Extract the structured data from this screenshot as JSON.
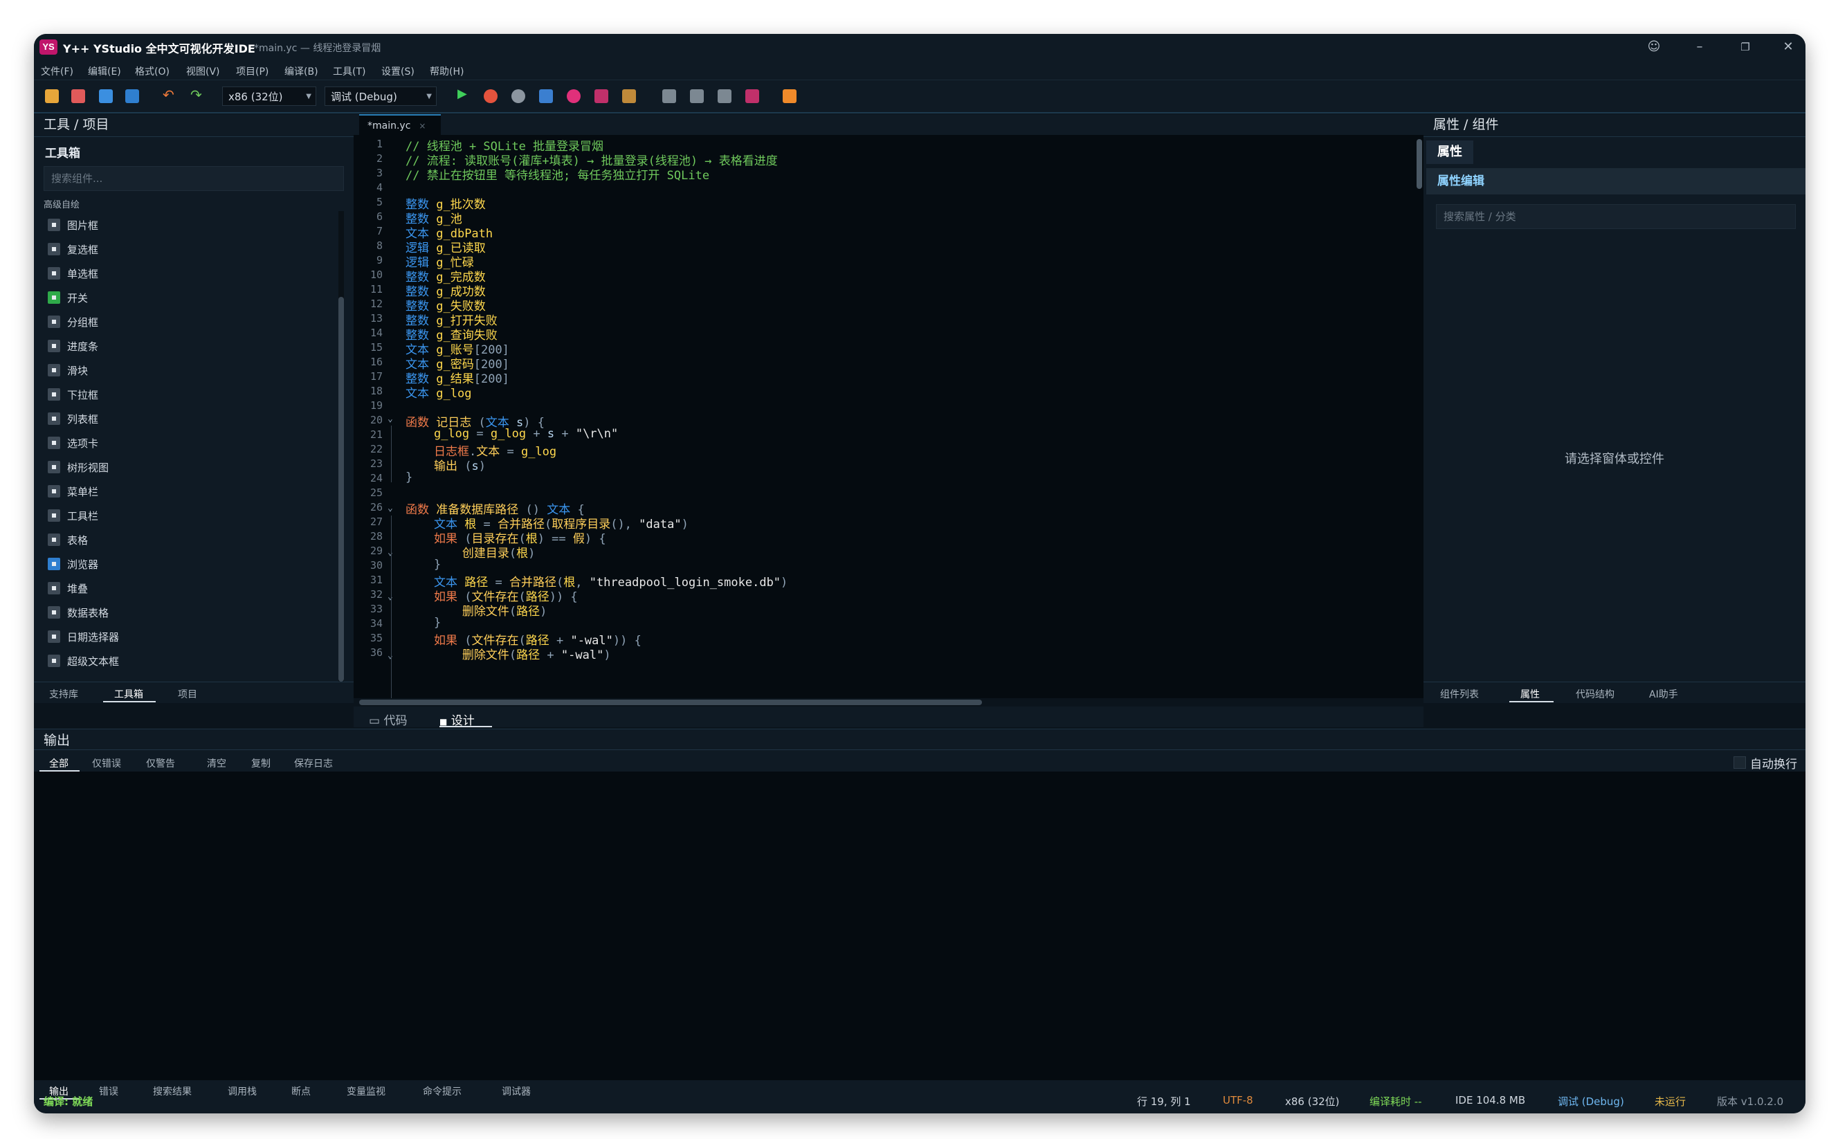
{
  "window": {
    "app_title": "Y++ YStudio 全中文可视化开发IDE",
    "doc_title": "*main.yc — 线程池登录冒烟",
    "logo": "YS"
  },
  "menu": [
    "文件(F)",
    "编辑(E)",
    "格式(O)",
    "视图(V)",
    "项目(P)",
    "编译(B)",
    "工具(T)",
    "设置(S)",
    "帮助(H)"
  ],
  "toolbar": {
    "arch": "x86 (32位)",
    "config": "调试 (Debug)"
  },
  "left": {
    "header": "工具 / 项目",
    "toolbox_title": "工具箱",
    "search_placeholder": "搜索组件...",
    "category": "高级自绘",
    "items": [
      "图片框",
      "复选框",
      "单选框",
      "开关",
      "分组框",
      "进度条",
      "滑块",
      "下拉框",
      "列表框",
      "选项卡",
      "树形视图",
      "菜单栏",
      "工具栏",
      "表格",
      "浏览器",
      "堆叠",
      "数据表格",
      "日期选择器",
      "超级文本框"
    ],
    "tabs": [
      "支持库",
      "工具箱",
      "项目"
    ]
  },
  "editor": {
    "tab": "*main.yc",
    "mode_tabs": [
      "代码",
      "设计"
    ],
    "line_numbers": [
      "1",
      "2",
      "3",
      "4",
      "5",
      "6",
      "7",
      "8",
      "9",
      "10",
      "11",
      "12",
      "13",
      "14",
      "15",
      "16",
      "17",
      "18",
      "19",
      "20",
      "21",
      "22",
      "23",
      "24",
      "25",
      "26",
      "27",
      "28",
      "29",
      "30",
      "31",
      "32",
      "33",
      "34",
      "35",
      "36"
    ]
  },
  "right": {
    "header": "属性 / 组件",
    "tab": "属性",
    "section": "属性编辑",
    "search_placeholder": "搜索属性 / 分类",
    "empty_hint": "请选择窗体或控件",
    "tabs": [
      "组件列表",
      "属性",
      "代码结构",
      "AI助手"
    ]
  },
  "output": {
    "title": "输出",
    "filters": [
      "全部",
      "仅错误",
      "仅警告",
      "清空",
      "复制",
      "保存日志"
    ],
    "wrap_label": "自动换行",
    "bottom_tabs": [
      "输出",
      "错误",
      "搜索结果",
      "调用栈",
      "断点",
      "变量监视",
      "命令提示",
      "调试器"
    ]
  },
  "status": {
    "compile": "编译: 就绪",
    "position": "行 19, 列 1",
    "encoding": "UTF-8",
    "arch": "x86 (32位)",
    "compile_time": "编译耗时 --",
    "memory": "IDE 104.8 MB",
    "config": "调试 (Debug)",
    "run_state": "未运行",
    "version": "版本 v1.0.2.0"
  },
  "colors": {
    "accent_green": "#6fc95c",
    "keyword_blue": "#3b96f0",
    "keyword_orange": "#f07a4a",
    "identifier_yellow": "#ffd84d",
    "status_orange": "#e08a3c"
  }
}
